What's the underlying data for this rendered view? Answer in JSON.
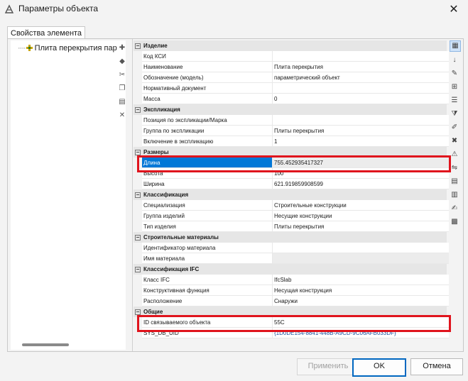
{
  "window": {
    "title": "Параметры объекта",
    "close_glyph": "✕"
  },
  "tab": {
    "label": "Свойства элемента"
  },
  "tree": {
    "items": [
      {
        "label": "Плита перекрытия пар"
      }
    ]
  },
  "left_toolbar": {
    "icons": [
      "add-property-icon",
      "tag-icon",
      "paste-icon",
      "copy-icon",
      "folder-icon",
      "delete-icon"
    ]
  },
  "properties": [
    {
      "kind": "category",
      "label": "Изделие"
    },
    {
      "kind": "prop",
      "name": "Код КСИ",
      "value": ""
    },
    {
      "kind": "prop",
      "name": "Наименование",
      "value": "Плита перекрытия"
    },
    {
      "kind": "prop",
      "name": "Обозначение (модель)",
      "value": "параметрический объект"
    },
    {
      "kind": "prop",
      "name": "Нормативный документ",
      "value": ""
    },
    {
      "kind": "prop",
      "name": "Масса",
      "value": "0"
    },
    {
      "kind": "category",
      "label": "Экспликация"
    },
    {
      "kind": "prop",
      "name": "Позиция по экспликации/Марка",
      "value": ""
    },
    {
      "kind": "prop",
      "name": "Группа по экспликации",
      "value": "Плиты перекрытия"
    },
    {
      "kind": "prop",
      "name": "Включение в экспликацию",
      "value": "1"
    },
    {
      "kind": "category",
      "label": "Размеры"
    },
    {
      "kind": "prop",
      "name": "Длина",
      "value": "755.452935417327",
      "selected": true
    },
    {
      "kind": "prop",
      "name": "Высота",
      "value": "100"
    },
    {
      "kind": "prop",
      "name": "Ширина",
      "value": "621.919859908599"
    },
    {
      "kind": "category",
      "label": "Классификация"
    },
    {
      "kind": "prop",
      "name": "Специализация",
      "value": "Строительные конструкции"
    },
    {
      "kind": "prop",
      "name": "Группа изделий",
      "value": "Несущие конструкции"
    },
    {
      "kind": "prop",
      "name": "Тип изделия",
      "value": "Плиты перекрытия"
    },
    {
      "kind": "category",
      "label": "Строительные материалы"
    },
    {
      "kind": "prop",
      "name": "Идентификатор материала",
      "value": ""
    },
    {
      "kind": "prop",
      "name": "Имя материала",
      "value": "",
      "readonly": true
    },
    {
      "kind": "category",
      "label": "Классификация IFC"
    },
    {
      "kind": "prop",
      "name": "Класс IFC",
      "value": "IfcSlab"
    },
    {
      "kind": "prop",
      "name": "Конструктивная функция",
      "value": "Несущая конструкция"
    },
    {
      "kind": "prop",
      "name": "Расположение",
      "value": "Снаружи"
    },
    {
      "kind": "category",
      "label": "Общие"
    },
    {
      "kind": "prop",
      "name": "ID связываемого объекта",
      "value": "55C"
    },
    {
      "kind": "prop",
      "name": "SYS_DB_UID",
      "value": "{1D0DE154-8841-448B-A9CD-9C06AFB033DF}",
      "blue": true
    }
  ],
  "right_toolbar": {
    "icons": [
      "categorized-view-icon",
      "sort-alphabetical-icon",
      "edit-property-icon",
      "add-property-icon",
      "list-icon",
      "filter-icon",
      "edit-icon",
      "remove-icon",
      "warning-icon",
      "link-icon",
      "grid-icon",
      "columns-icon",
      "signature-icon",
      "table-delete-icon"
    ]
  },
  "buttons": {
    "apply": "Применить",
    "ok": "OK",
    "cancel": "Отмена"
  },
  "colors": {
    "selection": "#0078d7",
    "highlight_box": "#e0141d",
    "primary_button": "#0067c0"
  }
}
